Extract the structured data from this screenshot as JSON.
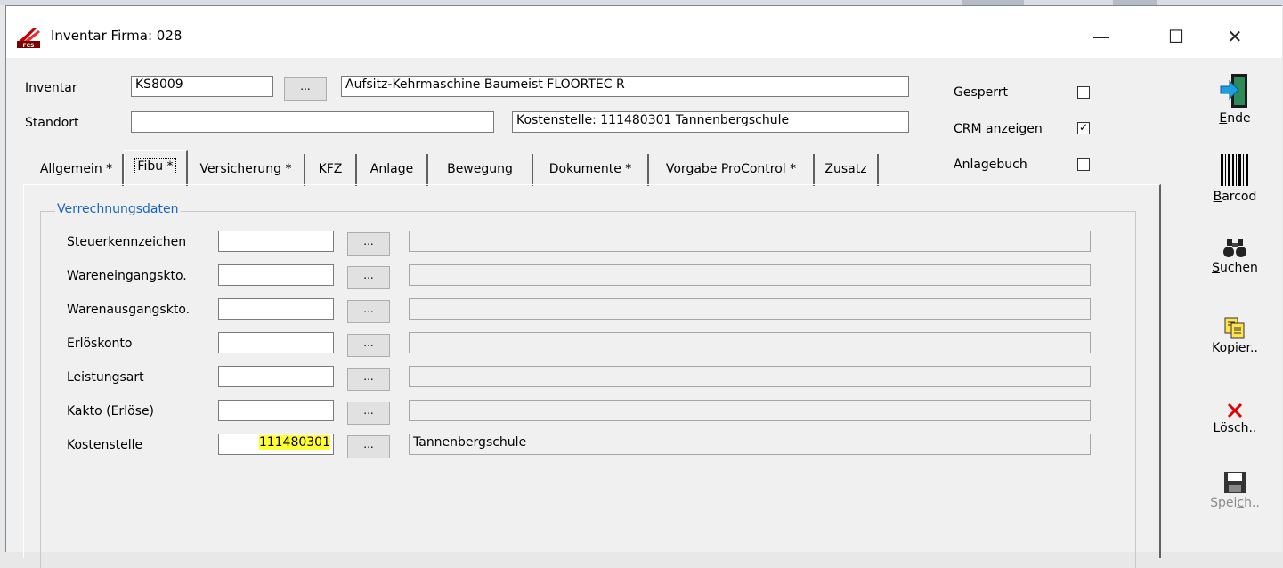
{
  "window": {
    "title": "Inventar Firma: 028",
    "controls": {
      "minimize": "—",
      "maximize": "☐",
      "close": "✕"
    }
  },
  "header": {
    "inventar": {
      "label": "Inventar",
      "value": "KS8009",
      "browse": "...",
      "description": "Aufsitz-Kehrmaschine Baumeist FLOORTEC R"
    },
    "standort": {
      "label": "Standort",
      "value": "",
      "info": "Kostenstelle: 111480301 Tannenbergschule"
    },
    "flags": [
      {
        "label": "Gesperrt",
        "checked": false,
        "mark": ""
      },
      {
        "label": "CRM anzeigen",
        "checked": true,
        "mark": "✓"
      },
      {
        "label": "Anlagebuch",
        "checked": false,
        "mark": ""
      }
    ]
  },
  "tabs": [
    {
      "label": "Allgemein *",
      "active": false
    },
    {
      "label": "Fibu *",
      "active": true
    },
    {
      "label": "Versicherung *",
      "active": false
    },
    {
      "label": "KFZ",
      "active": false
    },
    {
      "label": "Anlage",
      "active": false
    },
    {
      "label": "Bewegung",
      "active": false
    },
    {
      "label": "Dokumente *",
      "active": false
    },
    {
      "label": "Vorgabe ProControl *",
      "active": false
    },
    {
      "label": "Zusatz",
      "active": false
    }
  ],
  "fibu": {
    "group_title": "Verrechnungsdaten",
    "browse": "...",
    "rows": [
      {
        "label": "Steuerkennzeichen",
        "code": "",
        "text": ""
      },
      {
        "label": "Wareneingangskto.",
        "code": "",
        "text": ""
      },
      {
        "label": "Warenausgangskto.",
        "code": "",
        "text": ""
      },
      {
        "label": "Erlöskonto",
        "code": "",
        "text": ""
      },
      {
        "label": "Leistungsart",
        "code": "",
        "text": ""
      },
      {
        "label": "Kakto (Erlöse)",
        "code": "",
        "text": ""
      },
      {
        "label": "Kostenstelle",
        "code": "111480301",
        "text": "Tannenbergschule"
      }
    ]
  },
  "sidebar": [
    {
      "pre": "",
      "mnemonic": "E",
      "post": "nde",
      "icon": "exit-door-icon",
      "enabled": true
    },
    {
      "pre": "",
      "mnemonic": "B",
      "post": "arcod",
      "icon": "barcode-icon",
      "enabled": true
    },
    {
      "pre": "",
      "mnemonic": "S",
      "post": "uchen",
      "icon": "binoculars-icon",
      "enabled": true
    },
    {
      "pre": "",
      "mnemonic": "K",
      "post": "opier..",
      "icon": "copy-icon",
      "enabled": true
    },
    {
      "pre": "Lösch..",
      "mnemonic": "",
      "post": "",
      "icon": "delete-icon",
      "enabled": true
    },
    {
      "pre": "Spei",
      "mnemonic": "c",
      "post": "h..",
      "icon": "save-icon",
      "enabled": false
    }
  ],
  "colors": {
    "group_title": "#1565c0",
    "highlight": "#ffff33",
    "delete_red": "#e00000"
  }
}
